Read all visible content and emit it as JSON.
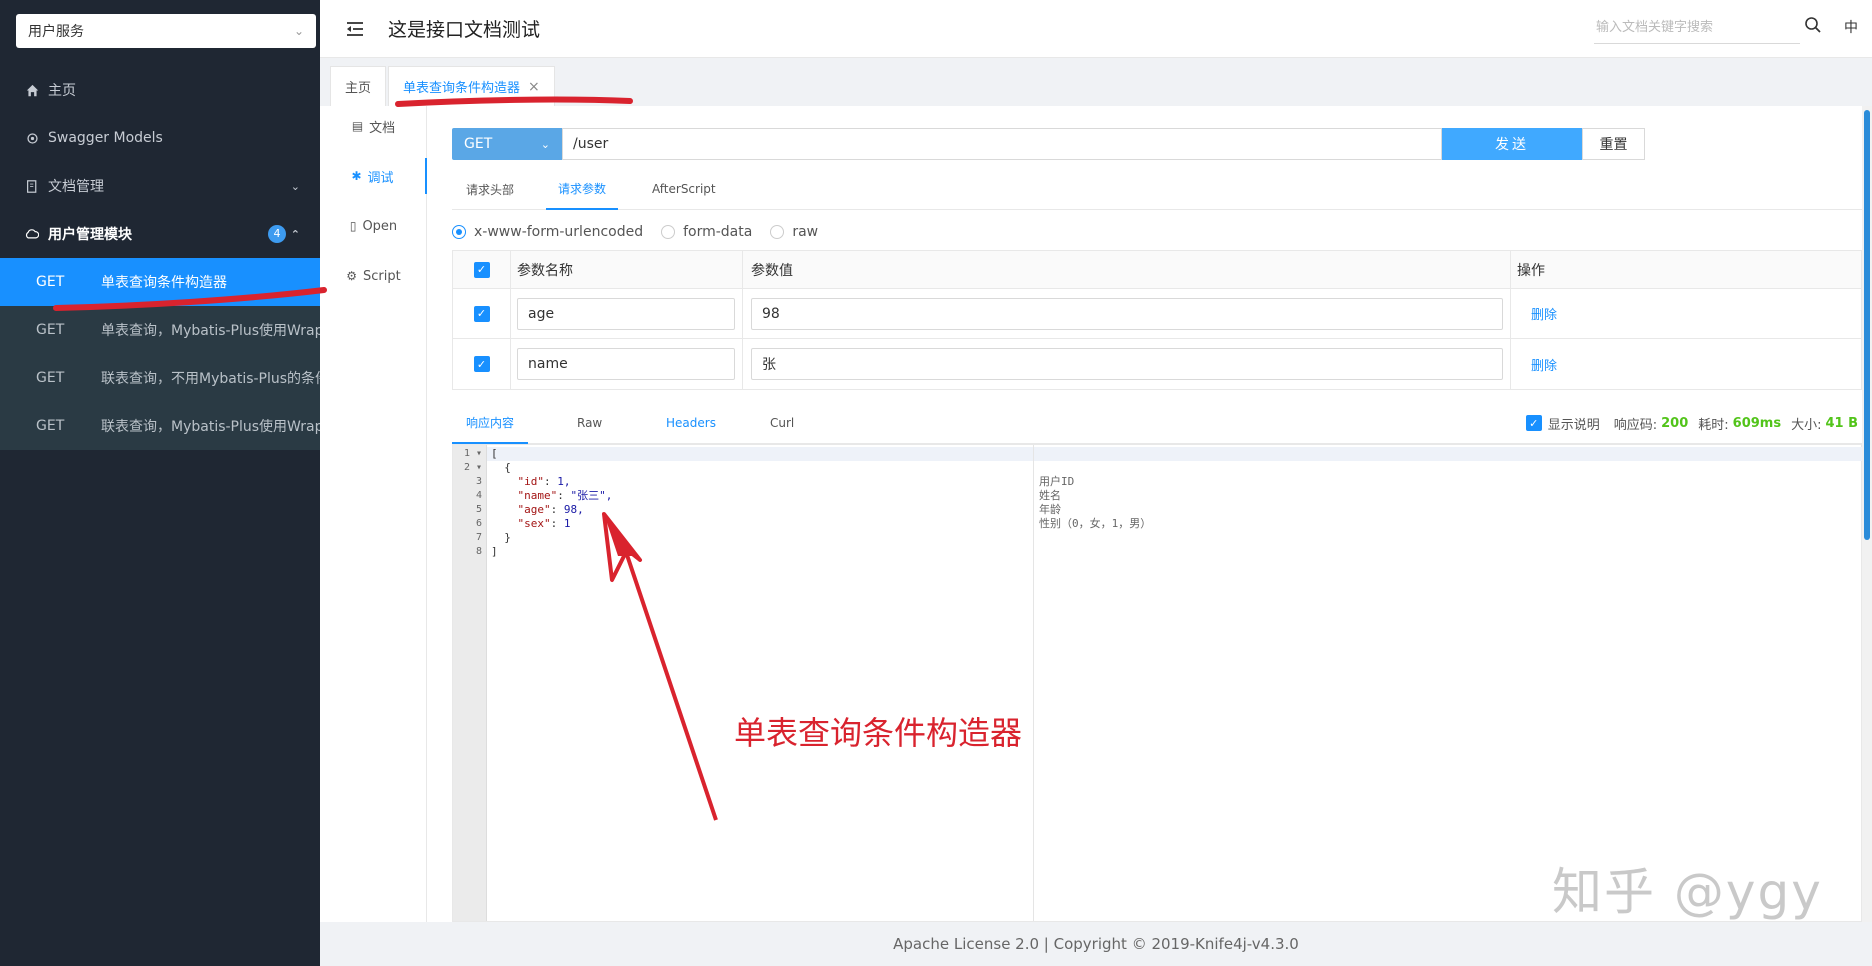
{
  "sidebar": {
    "service_select": "用户服务",
    "menu": [
      {
        "label": "主页",
        "icon": "home-icon"
      },
      {
        "label": "Swagger Models",
        "icon": "gear-icon"
      },
      {
        "label": "文档管理",
        "icon": "document-manage-icon"
      },
      {
        "label": "用户管理模块",
        "icon": "cloud-icon",
        "badge": "4"
      }
    ],
    "apis": [
      {
        "method": "GET",
        "title": "单表查询条件构造器"
      },
      {
        "method": "GET",
        "title": "单表查询，Mybatis-Plus使用Wrapp"
      },
      {
        "method": "GET",
        "title": "联表查询，不用Mybatis-Plus的条件"
      },
      {
        "method": "GET",
        "title": "联表查询，Mybatis-Plus使用Wrapp"
      }
    ]
  },
  "header": {
    "title": "这是接口文档测试",
    "search_placeholder": "输入文档关键字搜索",
    "lang": "中"
  },
  "tabs": [
    {
      "label": "主页"
    },
    {
      "label": "单表查询条件构造器",
      "close": "×"
    }
  ],
  "vnav": [
    {
      "label": "文档",
      "icon": "document-icon"
    },
    {
      "label": "调试",
      "icon": "bug-icon"
    },
    {
      "label": "Open",
      "icon": "file-icon"
    },
    {
      "label": "Script",
      "icon": "script-icon"
    }
  ],
  "request": {
    "method": "GET",
    "url": "/user",
    "send_label": "发送",
    "reset_label": "重置"
  },
  "request_tabs": [
    "请求头部",
    "请求参数",
    "AfterScript"
  ],
  "content_types": [
    "x-www-form-urlencoded",
    "form-data",
    "raw"
  ],
  "params_table": {
    "headers": [
      "参数名称",
      "参数值",
      "操作"
    ],
    "rows": [
      {
        "name": "age",
        "value": "98",
        "action": "删除"
      },
      {
        "name": "name",
        "value": "张",
        "action": "删除"
      }
    ]
  },
  "response": {
    "tabs": [
      "响应内容",
      "Raw",
      "Headers",
      "Curl"
    ],
    "show_desc_label": "显示说明",
    "code_label": "响应码:",
    "code": "200",
    "time_label": "耗时:",
    "time": "609ms",
    "size_label": "大小:",
    "size": "41 B",
    "lines": [
      {
        "no": "1",
        "fold": "▾",
        "text": "["
      },
      {
        "no": "2",
        "fold": "▾",
        "text": "  {"
      },
      {
        "no": "3",
        "fold": "",
        "key": "\"id\"",
        "sep": ": ",
        "val": "1,",
        "desc": "用户ID"
      },
      {
        "no": "4",
        "fold": "",
        "key": "\"name\"",
        "sep": ": ",
        "val": "\"张三\",",
        "desc": "姓名"
      },
      {
        "no": "5",
        "fold": "",
        "key": "\"age\"",
        "sep": ": ",
        "val": "98,",
        "desc": "年龄"
      },
      {
        "no": "6",
        "fold": "",
        "key": "\"sex\"",
        "sep": ": ",
        "val": "1",
        "desc": "性别（0，女，1，男）"
      },
      {
        "no": "7",
        "fold": "",
        "text": "  }"
      },
      {
        "no": "8",
        "fold": "",
        "text": "]"
      }
    ]
  },
  "annotation": "单表查询条件构造器",
  "watermark": "知乎 @ygy",
  "footer": "Apache License 2.0 | Copyright © 2019-Knife4j-v4.3.0",
  "colors": {
    "sidebar_bg": "#1f2733",
    "active_blue": "#1890ff",
    "annotation_red": "#d9232e",
    "success_green": "#52c41a"
  }
}
